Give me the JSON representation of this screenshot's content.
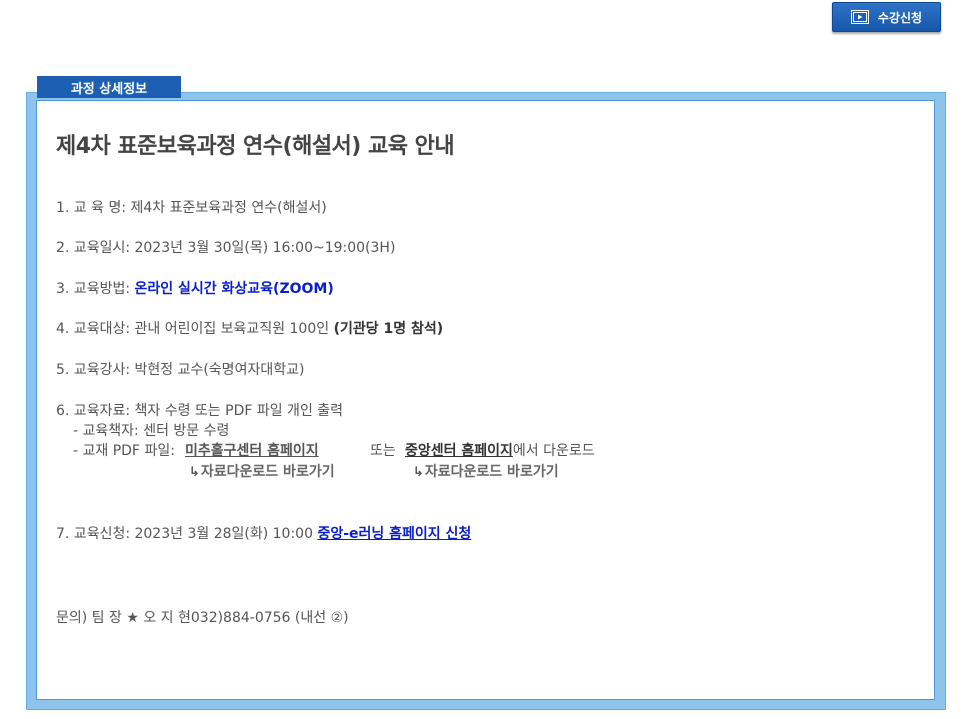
{
  "header": {
    "enroll_button": "수강신청",
    "tab_label": "과정 상세정보"
  },
  "course": {
    "title": "제4차 표준보육과정 연수(해설서) 교육 안내",
    "item1": "1. 교 육 명: 제4차 표준보육과정 연수(해설서)",
    "item2": "2. 교육일시: 2023년 3월 30일(목) 16:00~19:00(3H)",
    "item3_label": "3. 교육방법: ",
    "item3_value": "온라인 실시간 화상교육(ZOOM)",
    "item4_label": "4. 교육대상: 관내 어린이집 보육교직원 100인 ",
    "item4_value": "(기관당 1명 참석)",
    "item5": "5. 교육강사: 박현정 교수(숙명여자대학교)",
    "item6_title": "6. 교육자료: 책자 수령 또는 PDF 파일 개인 출력",
    "item6_book": "- 교육책자: 센터 방문 수령",
    "item6_pdf_label": "- 교재 PDF 파일: ",
    "item6_link1": "미추홀구센터 홈페이지",
    "item6_or": "또는",
    "item6_link2": "중앙센터 홈페이지",
    "item6_suffix": "에서   다운로드",
    "download_link1": "자료다운로드 바로가기",
    "download_link2": "자료다운로드 바로가기",
    "item7_label": "7. 교육신청: 2023년 3월 28일(화) 10:00 ",
    "item7_link": "중앙-e러닝 홈페이지 신청",
    "contact": "문의) 팀 장 ★ 오 지 현032)884-0756 (내선 ②)"
  }
}
